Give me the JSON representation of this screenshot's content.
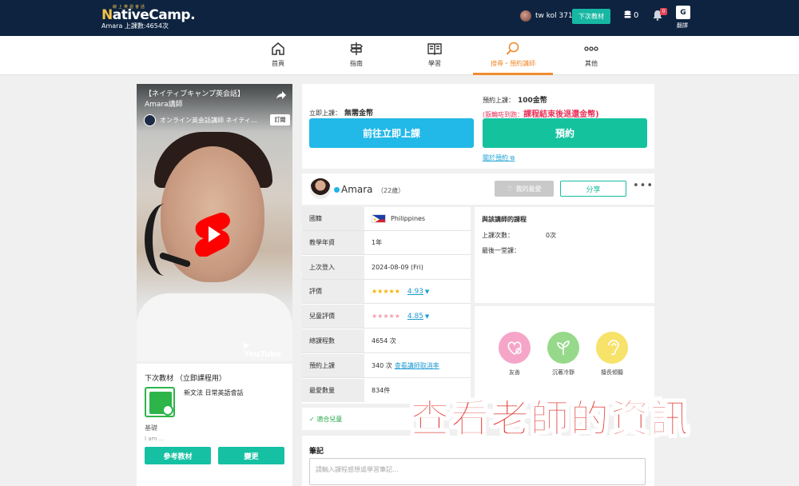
{
  "header": {
    "logo_tagline": "線上英語會話",
    "logo_name_prefix": "N",
    "logo_name_rest": "ativeCamp.",
    "user_line": "Amara  上課數:4654次",
    "username": "tw kol 371",
    "next_material_button": "下次教材",
    "coins": "0",
    "notification_badge": "0",
    "translate_label": "翻譯",
    "translate_icon_text": "G"
  },
  "nav": {
    "items": [
      {
        "label": "首頁",
        "icon": "home-icon"
      },
      {
        "label": "指南",
        "icon": "signpost-icon"
      },
      {
        "label": "學習",
        "icon": "book-icon"
      },
      {
        "label": "搜尋・預約講師",
        "icon": "search-icon",
        "active": true
      },
      {
        "label": "其他",
        "icon": "more-icon"
      }
    ],
    "active_color": "#f08c2f"
  },
  "video": {
    "title_line1": "【ネイティブキャンプ英会話】",
    "title_line2": "Amara講師",
    "channel_name": "オンライン英会話講師 ネイティ...",
    "subscribe": "訂閱",
    "brand": "YouTube"
  },
  "material": {
    "heading": "下次教材 （立即課程用）",
    "book_name": "新文法 日常英語會話",
    "level": "基礎",
    "desc": "I am ...",
    "reference_button": "參考教材",
    "change_button": "變更"
  },
  "booking": {
    "instant_label": "立即上課：",
    "instant_price": "無需金幣",
    "instant_button": "前往立即上課",
    "reserve_label": "預約上課：",
    "reserve_price": "100金幣",
    "note_prefix": "(翫輪咗到跑：",
    "note_highlight": "課程結束後退還金幣)",
    "reserve_button": "預約",
    "about_link": "關於預約"
  },
  "teacher": {
    "name": "Amara",
    "age": "（22歲）",
    "favorite_button": "我的最愛",
    "share_button": "分享",
    "more": "•••"
  },
  "info": {
    "rows": [
      {
        "key": "國籍",
        "value": "Philippines"
      },
      {
        "key": "教學年資",
        "value": "1年"
      },
      {
        "key": "上次登入",
        "value": "2024-08-09 (Fri)"
      },
      {
        "key": "評價",
        "stars": "★★★★★",
        "value": "4.93"
      },
      {
        "key": "兒童評價",
        "stars": "★★★★★",
        "value": "4.85"
      },
      {
        "key": "總課程數",
        "value": "4654 次"
      },
      {
        "key": "預約上課",
        "value": "340 次",
        "link": "查看講師取消率"
      },
      {
        "key": "最愛數量",
        "value": "834件"
      }
    ],
    "rating_color": "#f5b400",
    "kids_rating_color": "#f2a0b4"
  },
  "courses": {
    "heading": "與該講師的課程",
    "count_label": "上課次數：",
    "count_value": "0次",
    "last_label": "最後一堂課："
  },
  "traits": [
    {
      "label": "友善",
      "color": "#f5a6c8"
    },
    {
      "label": "沉著冷靜",
      "color": "#96d98a"
    },
    {
      "label": "擅長傾聽",
      "color": "#f7e26a"
    }
  ],
  "kids": {
    "label": "✓ 適合兒童"
  },
  "notes": {
    "heading": "筆記",
    "placeholder": "請輸入課程感想或學習筆記..."
  },
  "overlay_caption": "查看老師的資訊"
}
